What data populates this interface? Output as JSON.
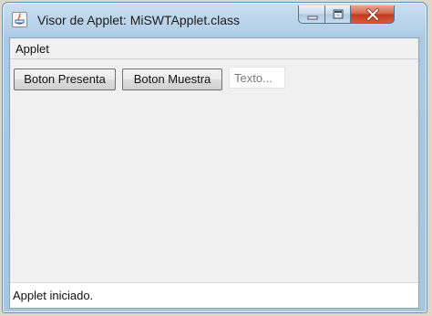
{
  "window": {
    "title": "Visor de Applet: MiSWTApplet.class",
    "controls": [
      "minimize-icon",
      "maximize-icon",
      "close-icon"
    ]
  },
  "menubar": {
    "items": [
      {
        "label": "Applet"
      }
    ]
  },
  "toolbar": {
    "buttons": [
      {
        "label": "Boton Presenta"
      },
      {
        "label": "Boton Muestra"
      }
    ],
    "text_field": {
      "value": "",
      "placeholder": "Texto..."
    }
  },
  "status": {
    "text": "Applet iniciado."
  },
  "colors": {
    "content_bg": "#f0f0f0",
    "frame": "#a8c6e0",
    "close_button": "#c8472c",
    "status_bg": "#ffffff"
  },
  "icons": {
    "app": "java-applet-icon"
  }
}
